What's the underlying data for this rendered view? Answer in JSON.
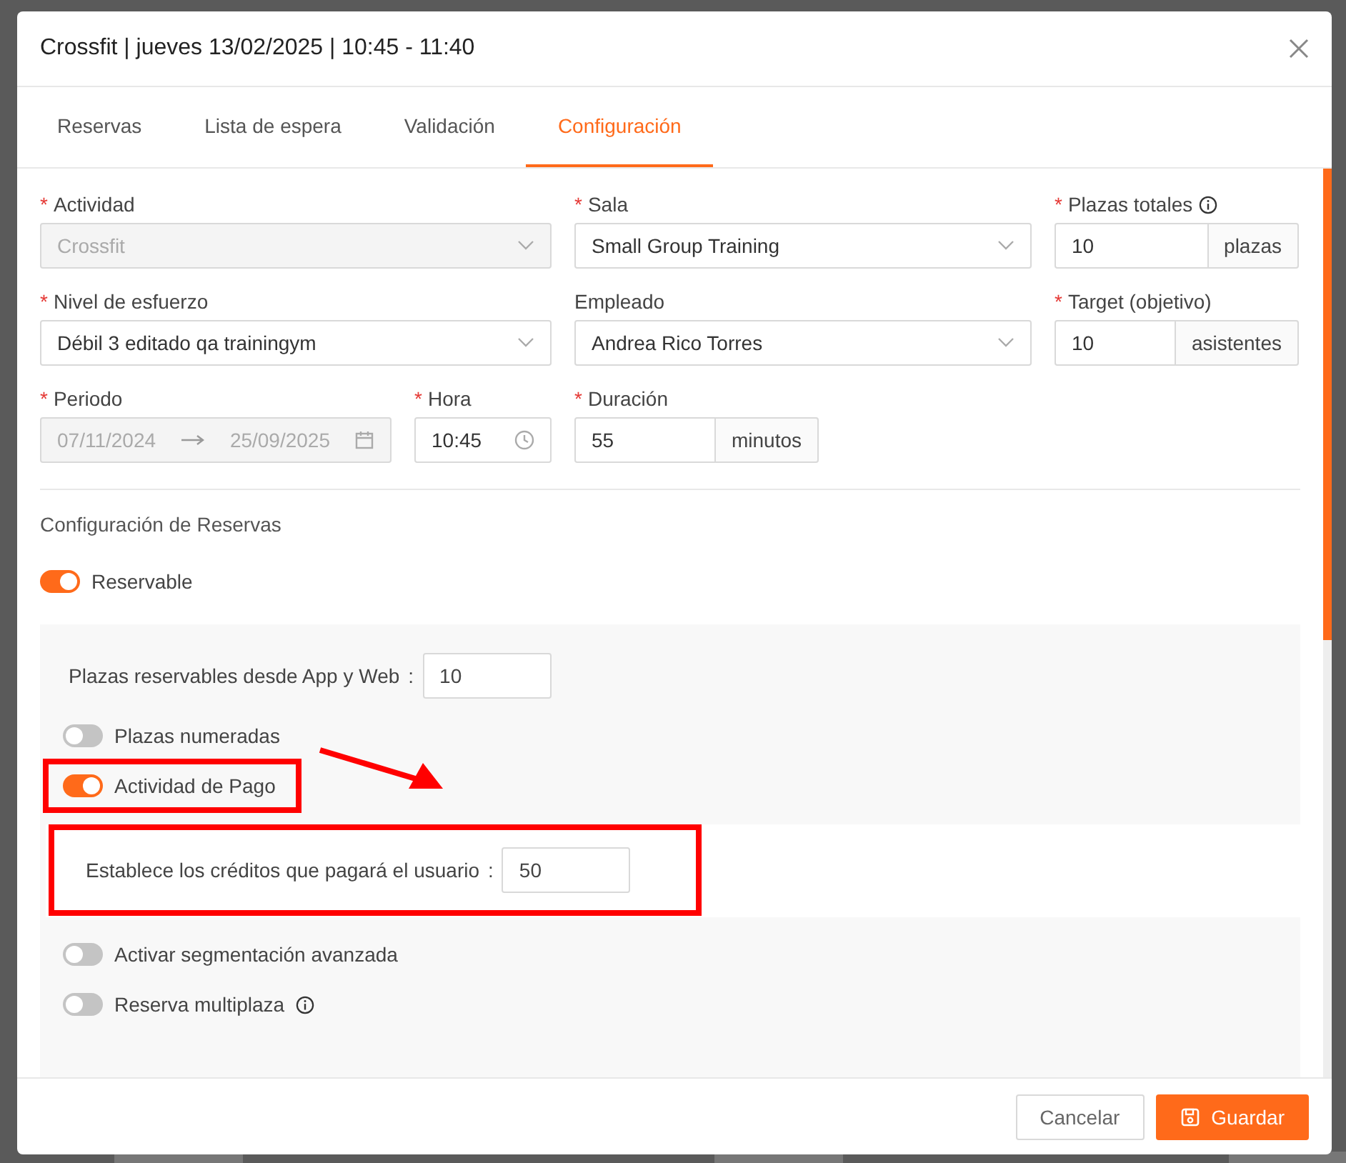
{
  "dialog": {
    "title": "Crossfit | jueves 13/02/2025 | 10:45 - 11:40",
    "tabs": [
      {
        "label": "Reservas",
        "selected": false
      },
      {
        "label": "Lista de espera",
        "selected": false
      },
      {
        "label": "Validación",
        "selected": false
      },
      {
        "label": "Configuración",
        "selected": true
      }
    ],
    "field_rows": [
      [
        {
          "kind": "select",
          "required_mark": "*",
          "label": "Actividad",
          "value": "Crossfit",
          "disabled": true
        },
        {
          "kind": "select",
          "required_mark": "*",
          "label": "Sala",
          "value": "Small Group Training",
          "disabled": false
        },
        {
          "kind": "addon",
          "required_mark": "*",
          "label": "Plazas totales",
          "info": true,
          "value": "10",
          "addon": "plazas"
        }
      ],
      [
        {
          "kind": "select",
          "required_mark": "*",
          "label": "Nivel de esfuerzo",
          "value": "Débil 3 editado qa trainingym",
          "disabled": false
        },
        {
          "kind": "select",
          "label": "Empleado",
          "value": "Andrea Rico Torres",
          "disabled": false
        },
        {
          "kind": "addon",
          "required_mark": "*",
          "label": "Target (objetivo)",
          "value": "10",
          "addon": "asistentes"
        }
      ],
      [
        {
          "kind": "daterange",
          "required_mark": "*",
          "label": "Periodo",
          "start": "07/11/2024",
          "end": "25/09/2025",
          "disabled": true
        },
        {
          "kind": "time",
          "required_mark": "*",
          "label": "Hora",
          "value": "10:45"
        },
        {
          "kind": "addon",
          "required_mark": "*",
          "label": "Duración",
          "value": "55",
          "addon": "minutos"
        }
      ]
    ],
    "section_title": "Configuración de Reservas",
    "reservable": {
      "label": "Reservable",
      "on": true
    },
    "panel_items": [
      {
        "kind": "input",
        "label": "Plazas reservables desde App y Web",
        "colon": ":",
        "value": "10",
        "highlighted": false
      },
      {
        "kind": "toggle",
        "label": "Plazas numeradas",
        "on": false,
        "highlighted": false
      },
      {
        "kind": "toggle",
        "label": "Actividad de Pago",
        "on": true,
        "highlighted": true
      },
      {
        "kind": "subinput",
        "label": "Establece los créditos que pagará el usuario",
        "colon": ":",
        "value": "50",
        "highlighted": true
      },
      {
        "kind": "toggle",
        "label": "Activar segmentación avanzada",
        "on": false,
        "highlighted": false
      },
      {
        "kind": "toggle",
        "label": "Reserva multiplaza",
        "on": false,
        "info": true,
        "highlighted": false
      }
    ],
    "buttons": [
      {
        "kind": "secondary",
        "label": "Cancelar"
      },
      {
        "kind": "primary",
        "label": "Guardar"
      }
    ]
  }
}
